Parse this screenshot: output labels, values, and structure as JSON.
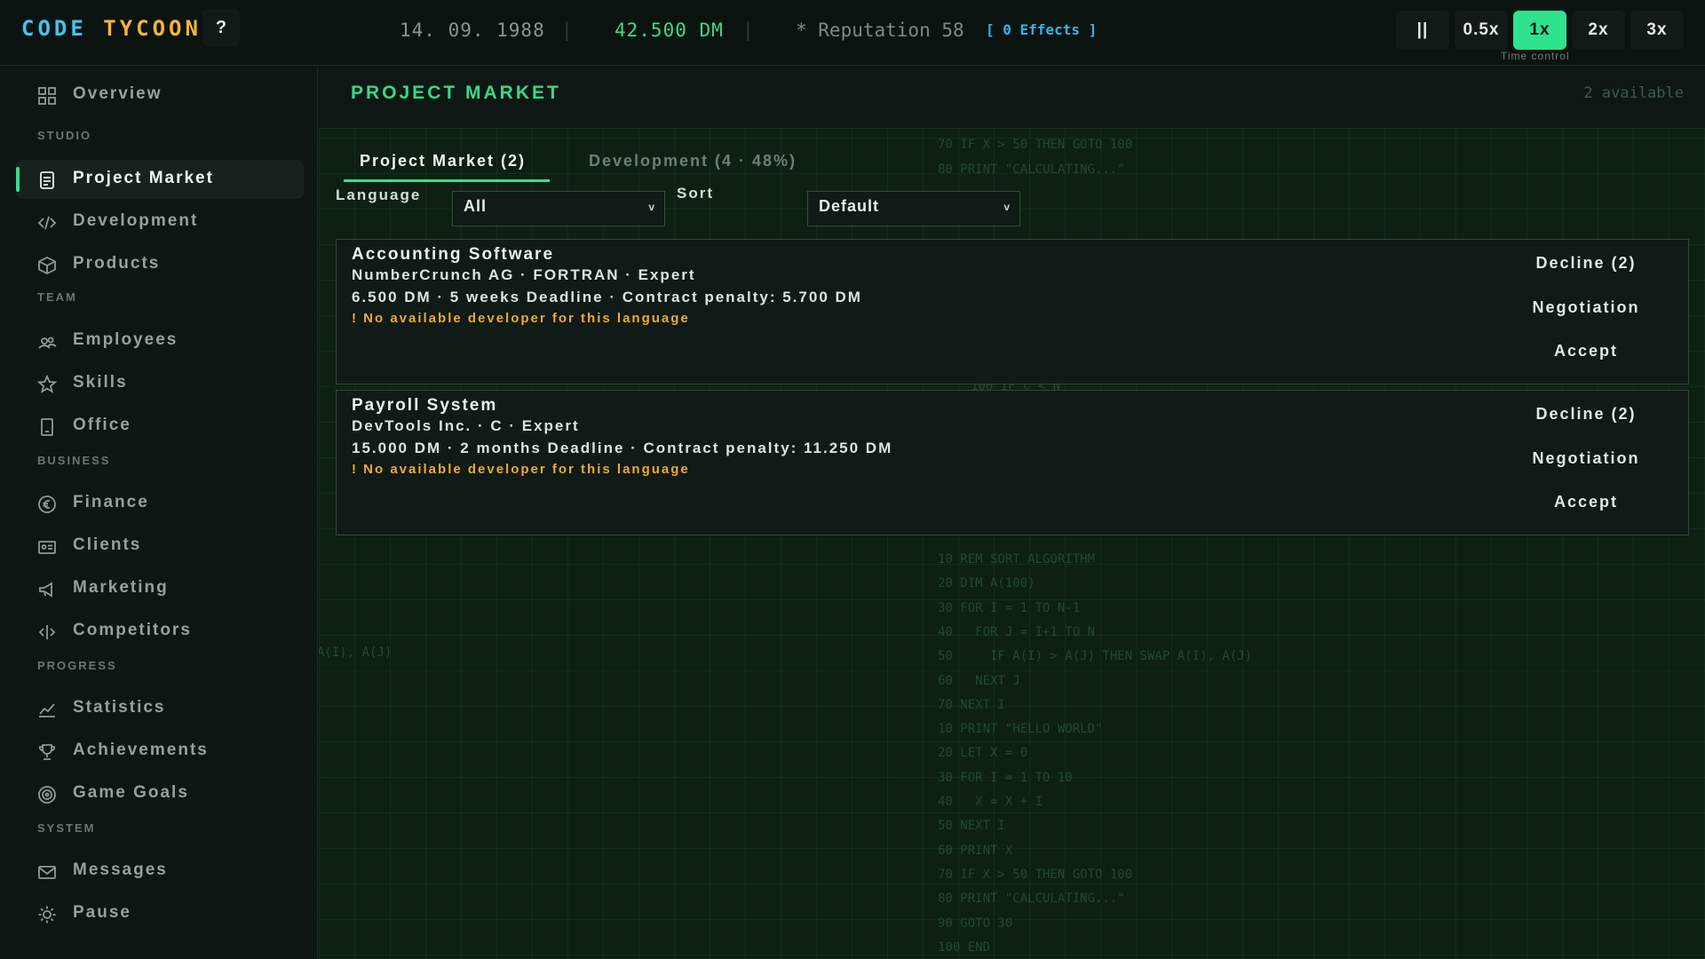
{
  "topbar": {
    "logo_part1": "CODE ",
    "logo_part2": "TYCOON",
    "help": "?",
    "date": "14. 09. 1988",
    "separator": "|",
    "money": "42.500 DM",
    "reputation": "* Reputation 58",
    "effects": "[ 0 Effects ]",
    "pause_label": "||",
    "speeds": [
      "0.5x",
      "1x",
      "2x",
      "3x"
    ],
    "active_speed": "1x",
    "time_control_label": "Time control"
  },
  "sidebar": {
    "overview": "Overview",
    "sections": {
      "studio": "STUDIO",
      "team": "TEAM",
      "business": "BUSINESS",
      "progress": "PROGRESS",
      "system": "SYSTEM"
    },
    "items": {
      "project_market": "Project Market",
      "development": "Development",
      "products": "Products",
      "employees": "Employees",
      "skills": "Skills",
      "office": "Office",
      "finance": "Finance",
      "clients": "Clients",
      "marketing": "Marketing",
      "competitors": "Competitors",
      "statistics": "Statistics",
      "achievements": "Achievements",
      "game_goals": "Game Goals",
      "messages": "Messages",
      "pause": "Pause"
    },
    "active": "project_market"
  },
  "main": {
    "title": "PROJECT MARKET",
    "available": "2 available",
    "tabs": [
      {
        "label": "Project Market (2)",
        "active": true
      },
      {
        "label": "Development (4 · 48%)",
        "active": false
      }
    ],
    "filters": {
      "language_label": "Language",
      "language_value": "All",
      "sort_label": "Sort",
      "sort_value": "Default",
      "chevron": "v"
    },
    "projects": [
      {
        "title": "Accounting Software",
        "client_line": "NumberCrunch AG  ·  FORTRAN  ·  Expert",
        "terms_line": "6.500 DM  ·  5 weeks Deadline  ·  Contract penalty: 5.700 DM",
        "warning": "! No available developer for this language",
        "decline": "Decline (2)",
        "negotiate": "Negotiation",
        "accept": "Accept"
      },
      {
        "title": "Payroll System",
        "client_line": "DevTools Inc.  ·  C  ·  Expert",
        "terms_line": "15.000 DM  ·  2 months Deadline  ·  Contract penalty: 11.250 DM",
        "warning": "! No available developer for this language",
        "decline": "Decline (2)",
        "negotiate": "Negotiation",
        "accept": "Accept"
      }
    ],
    "background_code": {
      "top": [
        "70 IF X > 50 THEN GOTO 100",
        "80 PRINT \"CALCULATING...\""
      ],
      "fragment": "100 IF C < N",
      "left_fragment": "A(I), A(J)",
      "bottom": [
        "10 REM SORT ALGORITHM",
        "20 DIM A(100)",
        "30 FOR I = 1 TO N-1",
        "40   FOR J = I+1 TO N",
        "50     IF A(I) > A(J) THEN SWAP A(I), A(J)",
        "60   NEXT J",
        "70 NEXT I",
        "10 PRINT \"HELLO WORLD\"",
        "20 LET X = 0",
        "30 FOR I = 1 TO 10",
        "40   X = X + I",
        "50 NEXT I",
        "60 PRINT X",
        "70 IF X > 50 THEN GOTO 100",
        "80 PRINT \"CALCULATING...\"",
        "90 GOTO 30",
        "100 END"
      ]
    }
  },
  "colors": {
    "accent": "#2fe28e",
    "logo_blue": "#3fc4f0",
    "logo_orange": "#f4b43a",
    "warning": "#f0a92f",
    "effects": "#36b4e6"
  }
}
